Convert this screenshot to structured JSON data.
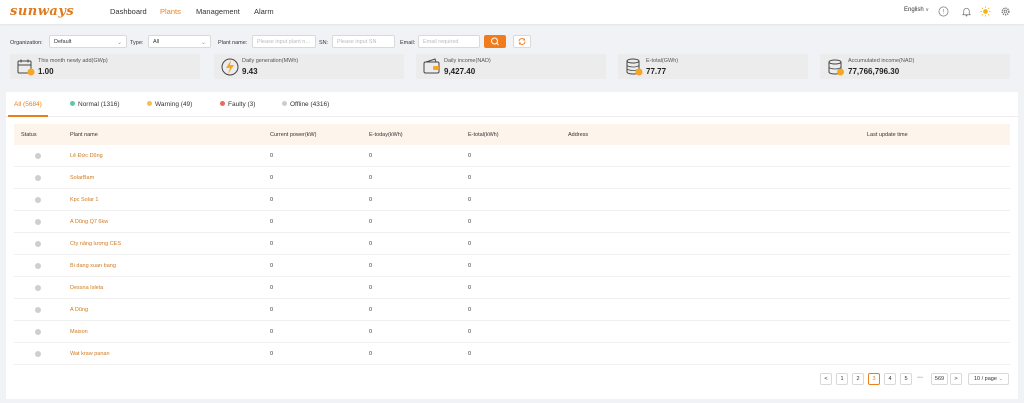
{
  "brand": {
    "logo_text": "sunways"
  },
  "nav": {
    "dashboard": "Dashboard",
    "plants": "Plants",
    "management": "Management",
    "alarm": "Alarm"
  },
  "header": {
    "language": "English"
  },
  "filters": {
    "organization_label": "Organization:",
    "organization_value": "Default",
    "type_label": "Type:",
    "type_value": "All",
    "plant_name_label": "Plant name:",
    "plant_name_placeholder": "Please input plant n...",
    "sn_label": "SN:",
    "sn_placeholder": "Please input SN",
    "email_label": "Email:",
    "email_placeholder": "Email required"
  },
  "stats": [
    {
      "label": "This month newly add(GWp)",
      "value": "1.00",
      "icon": "calendar-sun-icon"
    },
    {
      "label": "Daily generation(MWh)",
      "value": "9.43",
      "icon": "lightning-icon"
    },
    {
      "label": "Daily income(NAD)",
      "value": "9,427.40",
      "icon": "wallet-icon"
    },
    {
      "label": "E-total(GWh)",
      "value": "77.77",
      "icon": "battery-stack-icon"
    },
    {
      "label": "Accumulated income(NAD)",
      "value": "77,766,796.30",
      "icon": "coin-stack-icon"
    }
  ],
  "tabs": [
    {
      "label": "All",
      "count": "(5684)"
    },
    {
      "label": "Normal",
      "count": "(1316)",
      "color": "#5bc8a8"
    },
    {
      "label": "Warning",
      "count": "(49)",
      "color": "#f4c04a"
    },
    {
      "label": "Faulty",
      "count": "(3)",
      "color": "#e86a5a"
    },
    {
      "label": "Offline",
      "count": "(4316)",
      "color": "#cccccc"
    }
  ],
  "table": {
    "headers": {
      "status": "Status",
      "plant_name": "Plant name",
      "current_power": "Current power(kW)",
      "e_today": "E-today(kWh)",
      "e_total": "E-total(kWh)",
      "address": "Address",
      "last_update": "Last update time"
    },
    "rows": [
      {
        "name": "Lê Đức Dũng",
        "power": "0",
        "today": "0",
        "total": "0"
      },
      {
        "name": "SolarBam",
        "power": "0",
        "today": "0",
        "total": "0"
      },
      {
        "name": "Kpc Solar 1",
        "power": "0",
        "today": "0",
        "total": "0"
      },
      {
        "name": "A Dũng Q7 6kw",
        "power": "0",
        "today": "0",
        "total": "0"
      },
      {
        "name": "Cty năng lượng CES",
        "power": "0",
        "today": "0",
        "total": "0"
      },
      {
        "name": "Bi dang xuan bang",
        "power": "0",
        "today": "0",
        "total": "0"
      },
      {
        "name": "Dessna Isleta",
        "power": "0",
        "today": "0",
        "total": "0"
      },
      {
        "name": "A Dũng",
        "power": "0",
        "today": "0",
        "total": "0"
      },
      {
        "name": "Maison",
        "power": "0",
        "today": "0",
        "total": "0"
      },
      {
        "name": "Wat kraw panan",
        "power": "0",
        "today": "0",
        "total": "0"
      }
    ]
  },
  "pagination": {
    "prev": "<",
    "pages": [
      "1",
      "2",
      "3",
      "4",
      "5"
    ],
    "active_page": "3",
    "ellipsis": "•••",
    "last": "569",
    "next": ">",
    "page_size": "10 / page"
  },
  "colors": {
    "accent": "#e8811a",
    "brand": "#e07a1f"
  }
}
